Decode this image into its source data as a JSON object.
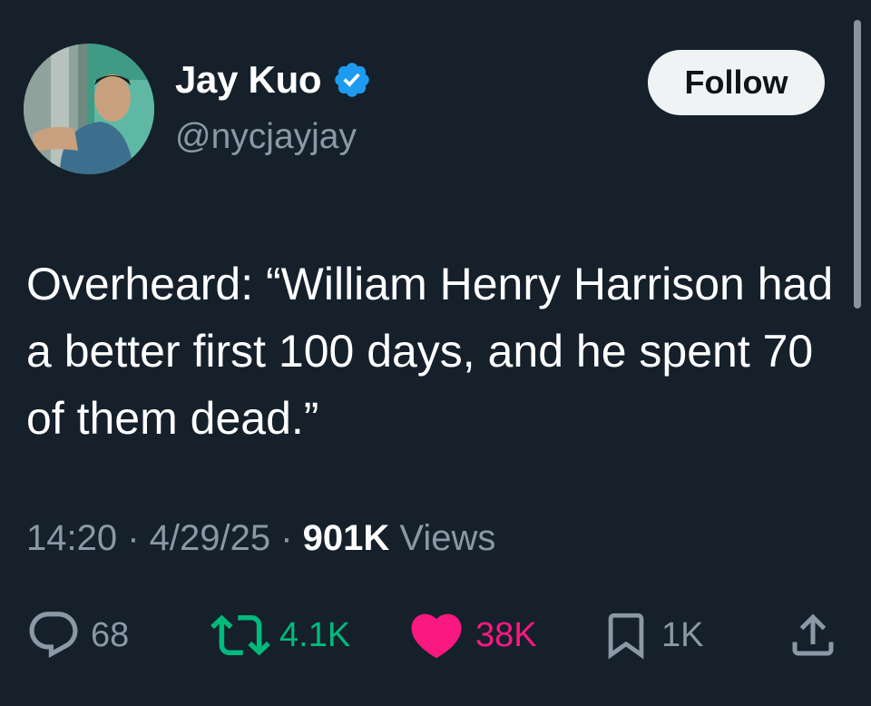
{
  "author": {
    "display_name": "Jay Kuo",
    "handle": "@nycjayjay",
    "verified": true,
    "avatar_icon": "avatar-photo",
    "verified_icon": "verified-badge-icon"
  },
  "follow_button": {
    "label": "Follow"
  },
  "tweet": {
    "text": "Overheard: “William Henry Harrison had a better first 100 days, and he spent 70 of them dead.”"
  },
  "meta": {
    "time": "14:20",
    "separator": " · ",
    "date": "4/29/25",
    "views_count": "901K",
    "views_label": " Views"
  },
  "actions": {
    "reply": {
      "icon": "reply-icon",
      "count": "68"
    },
    "retweet": {
      "icon": "retweet-icon",
      "count": "4.1K"
    },
    "like": {
      "icon": "heart-icon",
      "count": "38K"
    },
    "bookmark": {
      "icon": "bookmark-icon",
      "count": "1K"
    },
    "share": {
      "icon": "share-icon"
    }
  },
  "colors": {
    "background": "#15202b",
    "text_primary": "#ffffff",
    "text_secondary": "#8b98a5",
    "verified_blue": "#1d9bf0",
    "retweet_green": "#00ba7c",
    "like_pink": "#f91880",
    "follow_bg": "#eff3f4"
  }
}
